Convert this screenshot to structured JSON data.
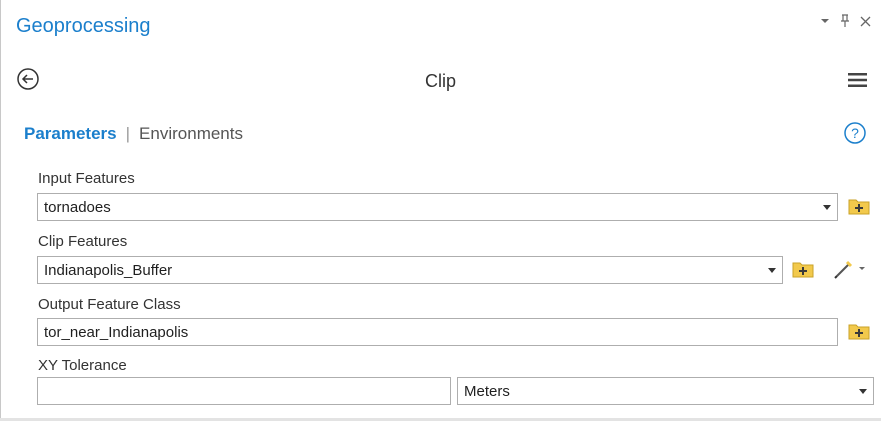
{
  "pane": {
    "title": "Geoprocessing",
    "controls": {
      "pin": "pin-icon",
      "close": "close-icon",
      "options": "caret-down-icon"
    }
  },
  "tool": {
    "title": "Clip"
  },
  "tabs": [
    {
      "label": "Parameters",
      "active": true
    },
    {
      "label": "Environments",
      "active": false
    }
  ],
  "tabs_separator": "|",
  "params": {
    "input_features": {
      "label": "Input Features",
      "value": "tornadoes"
    },
    "clip_features": {
      "label": "Clip Features",
      "value": "Indianapolis_Buffer"
    },
    "output_feature_class": {
      "label": "Output Feature Class",
      "value": "tor_near_Indianapolis"
    },
    "xy_tolerance": {
      "label": "XY Tolerance",
      "value": "",
      "unit": "Meters"
    }
  },
  "colors": {
    "accent": "#1b7fcc",
    "folder": "#f2c94c",
    "text": "#1f1f1f"
  }
}
